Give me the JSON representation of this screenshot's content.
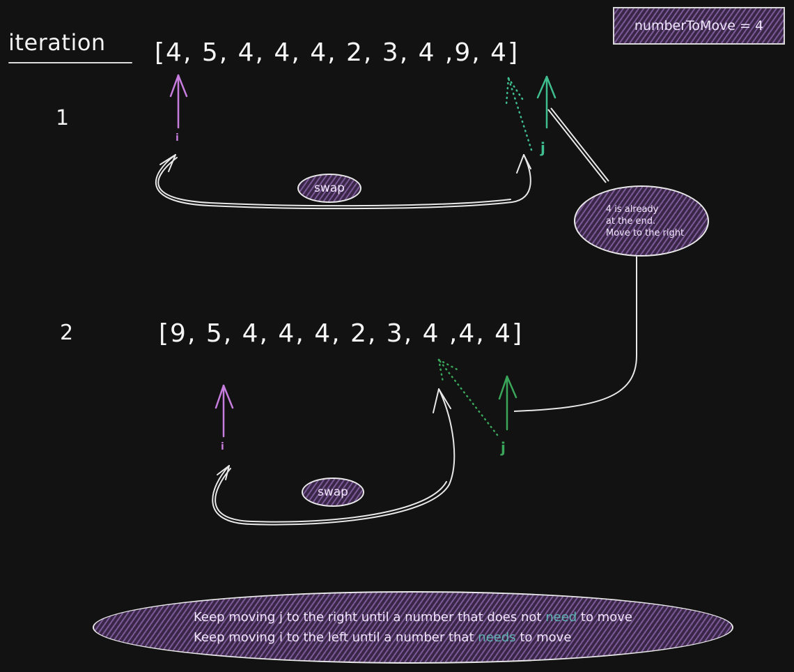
{
  "header": {
    "title": "iteration",
    "note": "numberToMove = 4"
  },
  "colors": {
    "background": "#121212",
    "i_pointer": "#c77dde",
    "j_pointer": "#3fbf8f",
    "j_pointer_iter2": "#3aa65a",
    "hatch_fill": "#3a2748",
    "highlight_word": "#5fb3b3",
    "stroke": "#e8e8e8"
  },
  "iterations": [
    {
      "number": "1",
      "array_text": "[4, 5, 4, 4, 4, 2, 3, 4 ,9, 4]",
      "values": [
        4,
        5,
        4,
        4,
        4,
        2,
        3,
        4,
        9,
        4
      ],
      "i_label": "i",
      "j_label": "j",
      "swap_label": "swap"
    },
    {
      "number": "2",
      "array_text": "[9, 5, 4, 4, 4, 2, 3, 4 ,4, 4]",
      "values": [
        9,
        5,
        4,
        4,
        4,
        2,
        3,
        4,
        4,
        4
      ],
      "i_label": "i",
      "j_label": "j",
      "swap_label": "swap"
    }
  ],
  "callout": {
    "lines": [
      "4 is already",
      "at the end.",
      "Move to the right"
    ]
  },
  "summary": {
    "line1": {
      "before": "Keep moving j to the right until a number that does not ",
      "highlight": "need",
      "after": " to move"
    },
    "line2": {
      "before": "Keep moving i to the left until a number that ",
      "highlight": "needs",
      "after": " to move"
    }
  }
}
